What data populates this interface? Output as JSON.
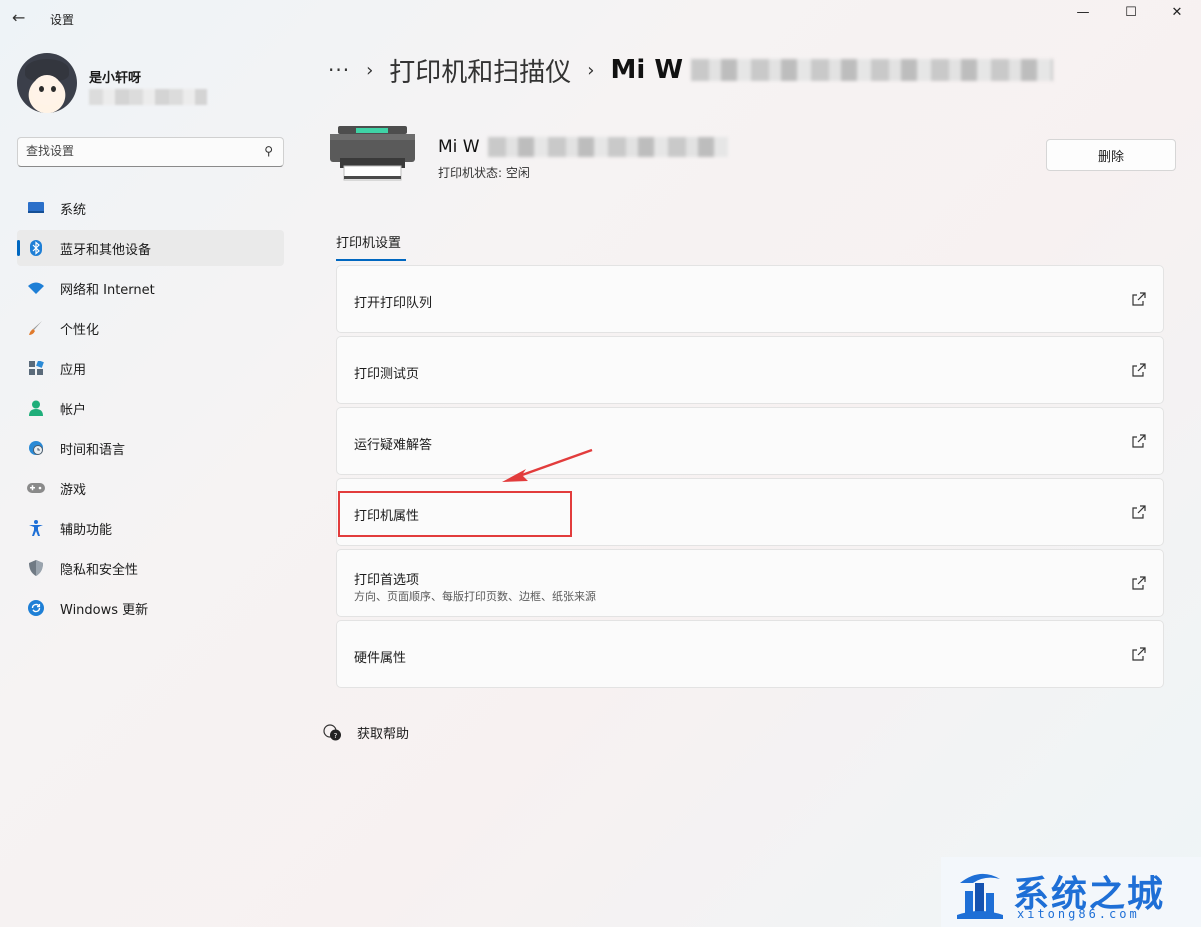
{
  "window": {
    "title": "设置",
    "controls": {
      "minimize": "—",
      "maximize": "☐",
      "close": "✕"
    }
  },
  "profile": {
    "name": "是小轩呀"
  },
  "search": {
    "placeholder": "查找设置"
  },
  "nav": {
    "items": [
      {
        "label": "系统",
        "icon": "monitor-icon",
        "color": "#2b6fc9"
      },
      {
        "label": "蓝牙和其他设备",
        "icon": "bluetooth-icon",
        "color": "#1e7fd6",
        "active": true
      },
      {
        "label": "网络和 Internet",
        "icon": "wifi-icon",
        "color": "#1e7fd6"
      },
      {
        "label": "个性化",
        "icon": "brush-icon",
        "color": "#e07a2c"
      },
      {
        "label": "应用",
        "icon": "apps-icon",
        "color": "#5a6a7a"
      },
      {
        "label": "帐户",
        "icon": "person-icon",
        "color": "#1fae7a"
      },
      {
        "label": "时间和语言",
        "icon": "clock-globe-icon",
        "color": "#2a8ad6"
      },
      {
        "label": "游戏",
        "icon": "gamepad-icon",
        "color": "#7a7a7a"
      },
      {
        "label": "辅助功能",
        "icon": "accessibility-icon",
        "color": "#1e6fd6"
      },
      {
        "label": "隐私和安全性",
        "icon": "shield-icon",
        "color": "#707a84"
      },
      {
        "label": "Windows 更新",
        "icon": "update-icon",
        "color": "#1e7fd6"
      }
    ]
  },
  "breadcrumb": {
    "more": "···",
    "sep": "›",
    "parent": "打印机和扫描仪",
    "current": "Mi W"
  },
  "printer": {
    "name": "Mi W",
    "status": "打印机状态: 空闲",
    "delete_label": "删除"
  },
  "section": {
    "title": "打印机设置"
  },
  "cards": [
    {
      "title": "打开打印队列"
    },
    {
      "title": "打印测试页"
    },
    {
      "title": "运行疑难解答"
    },
    {
      "title": "打印机属性",
      "highlighted": true
    },
    {
      "title": "打印首选项",
      "subtitle": "方向、页面顺序、每版打印页数、边框、纸张来源"
    },
    {
      "title": "硬件属性"
    }
  ],
  "help": {
    "label": "获取帮助"
  },
  "watermark": {
    "title": "系统之城",
    "url": "xitong86.com"
  },
  "colors": {
    "accent": "#0067c0",
    "highlight": "#e23c3c"
  }
}
